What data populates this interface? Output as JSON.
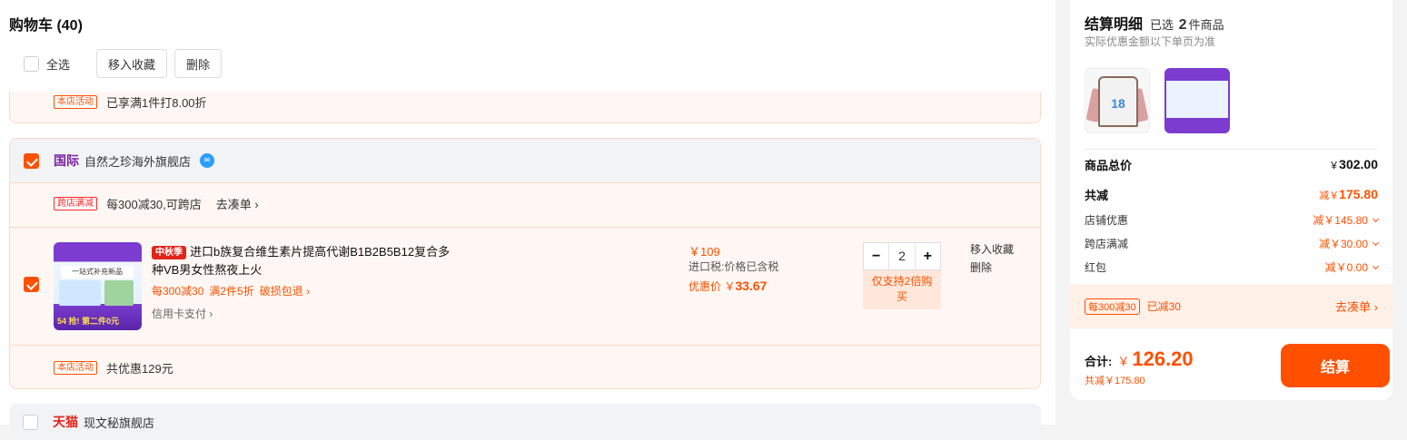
{
  "cart": {
    "title": "购物车 (40)",
    "select_all": "全选",
    "move_favorites": "移入收藏",
    "delete": "删除"
  },
  "shop1": {
    "activity_tag": "本店活动",
    "activity_text": "已享满1件打8.00折"
  },
  "shop2": {
    "badge": "国际",
    "name": "自然之珍海外旗舰店",
    "wang_icon": "aliwangwang-icon",
    "cross_tag": "跨店满减",
    "cross_text": "每300减30,可跨店",
    "go_collect": "去凑单 ›",
    "product": {
      "festival_tag": "中秋季",
      "title": "进口b族复合维生素片提高代谢B1B2B5B12复合多种VB男女性熬夜上火",
      "promos": [
        "每300减30",
        "满2件5折",
        "破损包退 ›"
      ],
      "card_pay": "信用卡支付 ›",
      "price": "￥109",
      "tax": "进口税:价格已含税",
      "discount_label": "优惠价 ￥",
      "discount_value": "33.67",
      "qty_minus": "−",
      "qty": "2",
      "qty_plus": "+",
      "qty_note": "仅支持2倍购买",
      "op_fav": "移入收藏",
      "op_del": "删除",
      "thumb_text": "一站式补充新品",
      "thumb_badge": "54",
      "thumb_promo": "抢! 第二件0元"
    },
    "activity_tag": "本店活动",
    "activity_text": "共优惠129元"
  },
  "shop3": {
    "badge": "天猫",
    "name": "现文秘旗舰店"
  },
  "summary": {
    "title": "结算明细",
    "selected_prefix": "已选",
    "selected_count": "2",
    "selected_suffix": "件商品",
    "note": "实际优惠金额以下单页为准",
    "thumb1_number": "18",
    "goods_total_label": "商品总价",
    "goods_total_cur": "￥",
    "goods_total": "302.00",
    "total_off_label": "共减",
    "total_off_prefix": "减￥",
    "total_off": "175.80",
    "rows": [
      {
        "label": "店铺优惠",
        "value": "减￥145.80"
      },
      {
        "label": "跨店满减",
        "value": "减￥30.00"
      },
      {
        "label": "红包",
        "value": "减￥0.00"
      }
    ],
    "bar_tag": "每300减30",
    "bar_text": "已减30",
    "bar_link": "去凑单 ›",
    "sum_label": "合计:",
    "sum_cur": "￥",
    "sum_value": "126.20",
    "saved": "共减￥175.80",
    "pay": "结算"
  },
  "colors": {
    "accent": "#ff5000",
    "intl": "#7a1fa2",
    "tmall": "#e1251b"
  }
}
